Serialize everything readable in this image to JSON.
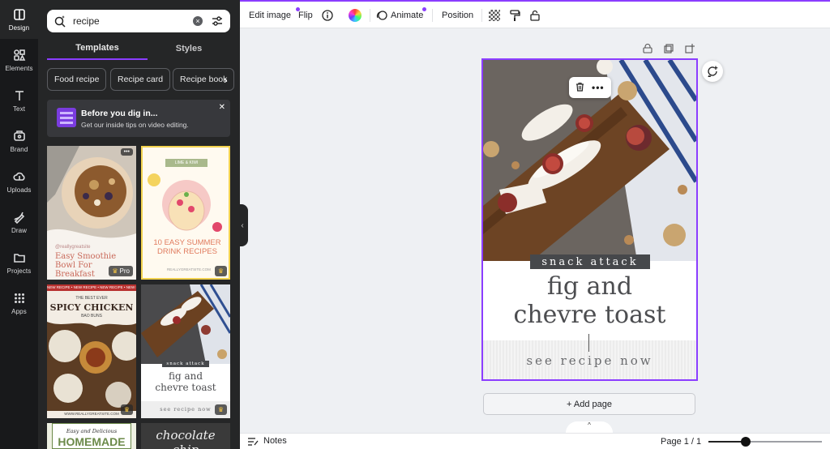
{
  "colors": {
    "accent": "#8b3dff",
    "rail": "#18191b",
    "panel": "#252627"
  },
  "rail": [
    {
      "label": "Design",
      "icon": "design-icon",
      "active": true
    },
    {
      "label": "Elements",
      "icon": "elements-icon"
    },
    {
      "label": "Text",
      "icon": "text-icon"
    },
    {
      "label": "Brand",
      "icon": "brand-icon"
    },
    {
      "label": "Uploads",
      "icon": "uploads-icon"
    },
    {
      "label": "Draw",
      "icon": "draw-icon"
    },
    {
      "label": "Projects",
      "icon": "projects-icon"
    },
    {
      "label": "Apps",
      "icon": "apps-icon"
    }
  ],
  "search": {
    "value": "recipe"
  },
  "tabs": [
    {
      "label": "Templates",
      "active": true
    },
    {
      "label": "Styles"
    }
  ],
  "chips": [
    {
      "label": "Food recipe"
    },
    {
      "label": "Recipe card"
    },
    {
      "label": "Recipe book"
    }
  ],
  "notice": {
    "title": "Before you dig in...",
    "subtitle": "Get our inside tips on video editing.",
    "close": "✕"
  },
  "templates": {
    "t1": {
      "handle": "@reallygreatsite",
      "title": "Easy Smoothie Bowl For Breakfast",
      "badge": "Pro",
      "more": "•••"
    },
    "t2": {
      "tag": "LIME & KIWI",
      "title": "10 EASY SUMMER DRINK RECIPES",
      "site": "REALLYGREATSITE.COM"
    },
    "t3": {
      "ticker": "NEW RECIPE • NEW RECIPE • NEW RECIPE • NEW RECIPE",
      "pre": "THE BEST EVER",
      "title": "SPICY CHICKEN",
      "sub": "BAO BUNS",
      "site": "WWW.REALLYGREATSITE.COM"
    },
    "t4": {
      "tag": "snack attack",
      "title_l1": "fig and",
      "title_l2": "chevre toast",
      "cta": "see recipe now"
    },
    "t5": {
      "pre": "Easy and Delicious",
      "title": "HOMEMADE"
    },
    "t6": {
      "title": "chocolate chip"
    }
  },
  "toolbar": {
    "edit_image": "Edit image",
    "flip": "Flip",
    "animate": "Animate",
    "position": "Position"
  },
  "design": {
    "tag": "snack attack",
    "title_l1": "fig and",
    "title_l2": "chevre toast",
    "cta": "see recipe now"
  },
  "add_page": "+ Add page",
  "bottom": {
    "notes": "Notes",
    "page_count": "Page 1 / 1",
    "zoom": 0.33
  }
}
